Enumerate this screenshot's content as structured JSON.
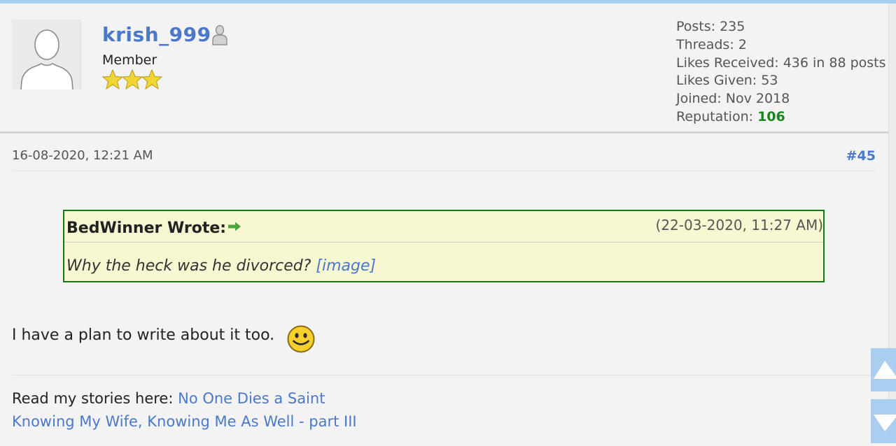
{
  "user": {
    "name": "krish_999",
    "title": "Member",
    "status_icon": "offline-person-icon",
    "star_count": 3,
    "star_color": "#f1d535"
  },
  "stats": {
    "posts": "Posts: 235",
    "threads": "Threads: 2",
    "likes_received": "Likes Received: 436 in 88 posts",
    "likes_given": "Likes Given: 53",
    "joined": "Joined: Nov 2018",
    "reputation_label": "Reputation: ",
    "reputation_value": "106"
  },
  "post": {
    "date": "16-08-2020, 12:21 AM",
    "number": "#45",
    "quote": {
      "author": "BedWinner Wrote:",
      "date": "(22-03-2020, 11:27 AM)",
      "text": "Why the heck was he divorced? ",
      "image_link": "[image]"
    },
    "body": "I have a plan to write about it too."
  },
  "signature": {
    "prefix": "Read my stories here: ",
    "link1": "No One Dies a Saint",
    "link2": "Knowing My Wife, Knowing Me As Well - part III"
  },
  "colors": {
    "link": "#4b78c8",
    "reputation": "#18851c",
    "quote_border": "#127a12",
    "quote_bg": "#f7f7d2",
    "scroll_button": "#a9cef0"
  }
}
